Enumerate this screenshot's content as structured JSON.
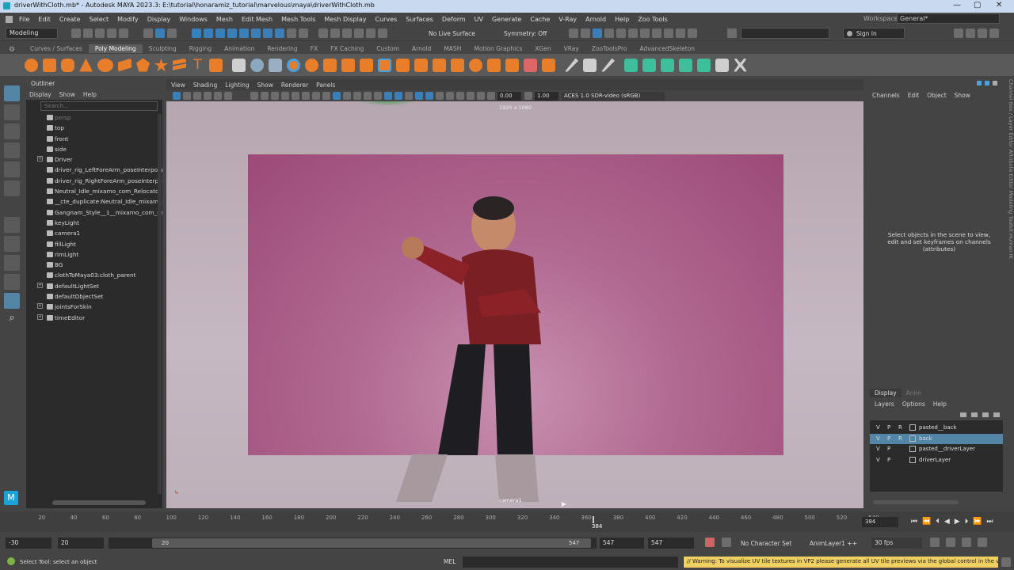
{
  "window": {
    "title": "driverWithCloth.mb* - Autodesk MAYA 2023.3: E:\\tutorial\\honaramiz_tutorial\\marvelous\\maya\\driverWithCloth.mb",
    "minimize": "—",
    "maximize": "▢",
    "close": "✕"
  },
  "menubar": {
    "items": [
      "File",
      "Edit",
      "Create",
      "Select",
      "Modify",
      "Display",
      "Windows",
      "Mesh",
      "Edit Mesh",
      "Mesh Tools",
      "Mesh Display",
      "Curves",
      "Surfaces",
      "Deform",
      "UV",
      "Generate",
      "Cache",
      "V-Ray",
      "Arnold",
      "Help",
      "Zoo Tools"
    ],
    "workspace_label": "Workspace:",
    "workspace_value": "General*"
  },
  "statusline": {
    "mode": "Modeling",
    "live_surface": "No Live Surface",
    "symmetry": "Symmetry: Off",
    "sign_in": "Sign In"
  },
  "shelf": {
    "tabs": [
      "Curves / Surfaces",
      "Poly Modeling",
      "Sculpting",
      "Rigging",
      "Animation",
      "Rendering",
      "FX",
      "FX Caching",
      "Custom",
      "Arnold",
      "MASH",
      "Motion Graphics",
      "XGen",
      "VRay",
      "ZooToolsPro",
      "AdvancedSkeleton"
    ],
    "active_tab": "Poly Modeling"
  },
  "outliner": {
    "title": "Outliner",
    "menu": [
      "Display",
      "Show",
      "Help"
    ],
    "search_placeholder": "Search...",
    "items": [
      {
        "label": "persp",
        "dim": true,
        "expand": false
      },
      {
        "label": "top",
        "dim": false,
        "expand": false
      },
      {
        "label": "front",
        "dim": false,
        "expand": false
      },
      {
        "label": "side",
        "dim": false,
        "expand": false
      },
      {
        "label": "Driver",
        "dim": false,
        "expand": true
      },
      {
        "label": "driver_rig_LeftForeArm_poseInterpola",
        "dim": false,
        "expand": false
      },
      {
        "label": "driver_rig_RightForeArm_poseInterpo",
        "dim": false,
        "expand": false
      },
      {
        "label": "Neutral_Idle_mixamo_com_Relocator",
        "dim": false,
        "expand": false
      },
      {
        "label": "__cte_duplicate:Neutral_Idle_mixamo_",
        "dim": false,
        "expand": false
      },
      {
        "label": "Gangnam_Style__1__mixamo_com_Rel",
        "dim": false,
        "expand": false
      },
      {
        "label": "keyLight",
        "dim": false,
        "expand": false
      },
      {
        "label": "camera1",
        "dim": false,
        "expand": false
      },
      {
        "label": "fillLight",
        "dim": false,
        "expand": false
      },
      {
        "label": "rimLight",
        "dim": false,
        "expand": false
      },
      {
        "label": "BG",
        "dim": false,
        "expand": false
      },
      {
        "label": "clothToMaya03:cloth_parent",
        "dim": false,
        "expand": false
      },
      {
        "label": "defaultLightSet",
        "dim": false,
        "expand": true
      },
      {
        "label": "defaultObjectSet",
        "dim": false,
        "expand": false
      },
      {
        "label": "jointsForSkin",
        "dim": false,
        "expand": true
      },
      {
        "label": "timeEditor",
        "dim": false,
        "expand": true
      }
    ]
  },
  "viewport": {
    "menu": [
      "View",
      "Shading",
      "Lighting",
      "Show",
      "Renderer",
      "Panels"
    ],
    "exposure": "0.00",
    "gamma": "1.00",
    "color_space": "ACES 1.0 SDR-video (sRGB)",
    "resolution_label": "1920 x 1080",
    "camera_label": "camera1"
  },
  "channelbox": {
    "menu": [
      "Channels",
      "Edit",
      "Object",
      "Show"
    ],
    "hint": "Select objects in the scene to view, edit and set keyframes on channels (attributes)"
  },
  "layers": {
    "tabs": [
      "Display",
      "Anim"
    ],
    "menu": [
      "Layers",
      "Options",
      "Help"
    ],
    "rows": [
      {
        "v": "V",
        "p": "P",
        "r": "R",
        "name": "pasted__back",
        "selected": false
      },
      {
        "v": "V",
        "p": "P",
        "r": "R",
        "name": "back",
        "selected": true
      },
      {
        "v": "V",
        "p": "P",
        "r": "",
        "name": "pasted__driverLayer",
        "selected": false
      },
      {
        "v": "V",
        "p": "P",
        "r": "",
        "name": "driverLayer",
        "selected": false
      }
    ]
  },
  "side_tabs": "Channel Box / Layer Editor    Attribute Editor    Modeling Toolkit    Human IK",
  "timeline": {
    "ticks": [
      "20",
      "40",
      "60",
      "80",
      "100",
      "120",
      "140",
      "160",
      "180",
      "200",
      "220",
      "240",
      "260",
      "280",
      "300",
      "320",
      "340",
      "360",
      "380",
      "400",
      "420",
      "440",
      "460",
      "480",
      "500",
      "520",
      "540"
    ],
    "current_frame": "384",
    "current_frame_field": "384"
  },
  "range": {
    "start": "-30",
    "playback_start": "20",
    "slider_start": "20",
    "slider_end": "547",
    "playback_end": "547",
    "end": "547",
    "character_set": "No Character Set",
    "anim_layer": "AnimLayer1 ++",
    "fps": "30 fps"
  },
  "cmdline": {
    "help": "Select Tool: select an object",
    "lang": "MEL",
    "warning": "// Warning: To visualize UV tile textures in VP2 please generate all UV tile previews via the global control in the vie"
  },
  "colors": {
    "accent": "#5285a6",
    "background": "#444444",
    "backdrop": "#b06890"
  }
}
